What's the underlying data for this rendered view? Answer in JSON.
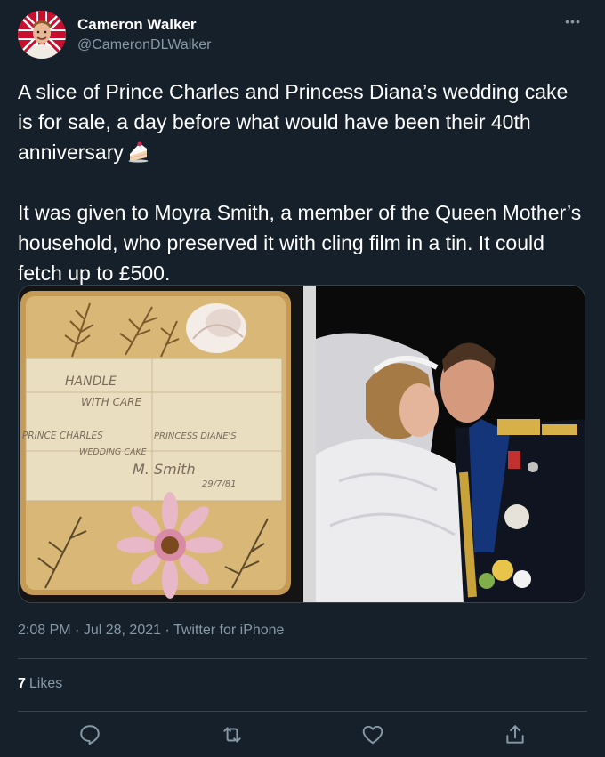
{
  "author": {
    "name": "Cameron Walker",
    "handle": "@CameronDLWalker",
    "avatar_icon": "profile-avatar"
  },
  "more_icon": "more-horizontal-icon",
  "tweet": {
    "paragraph1": "A slice of Prince Charles and Princess Diana’s wedding cake is for sale, a day before what would have been their 40th anniversary",
    "emoji_icon": "cake-slice-emoji",
    "paragraph2": "It was given to Moyra Smith, a member of the Queen Mother’s household, who preserved it with cling film in a tin. It could fetch up to £500."
  },
  "media": {
    "left_image": {
      "handwriting": [
        "HANDLE",
        "WITH CARE",
        "PRINCE CHARLES",
        "PRINCESS DIANE'S",
        "WEDDING CAKE",
        "M. Smith",
        "29/7/81"
      ]
    },
    "right_image": {}
  },
  "meta": {
    "time": "2:08 PM",
    "sep": "·",
    "date": "Jul 28, 2021",
    "source": "Twitter for iPhone"
  },
  "likes": {
    "count": "7",
    "label": "Likes"
  },
  "actions": {
    "reply_icon": "reply-icon",
    "retweet_icon": "retweet-icon",
    "like_icon": "heart-icon",
    "share_icon": "share-icon"
  },
  "colors": {
    "background": "#15202b",
    "text": "#ffffff",
    "secondary": "#8899a6",
    "divider": "#38444d"
  }
}
